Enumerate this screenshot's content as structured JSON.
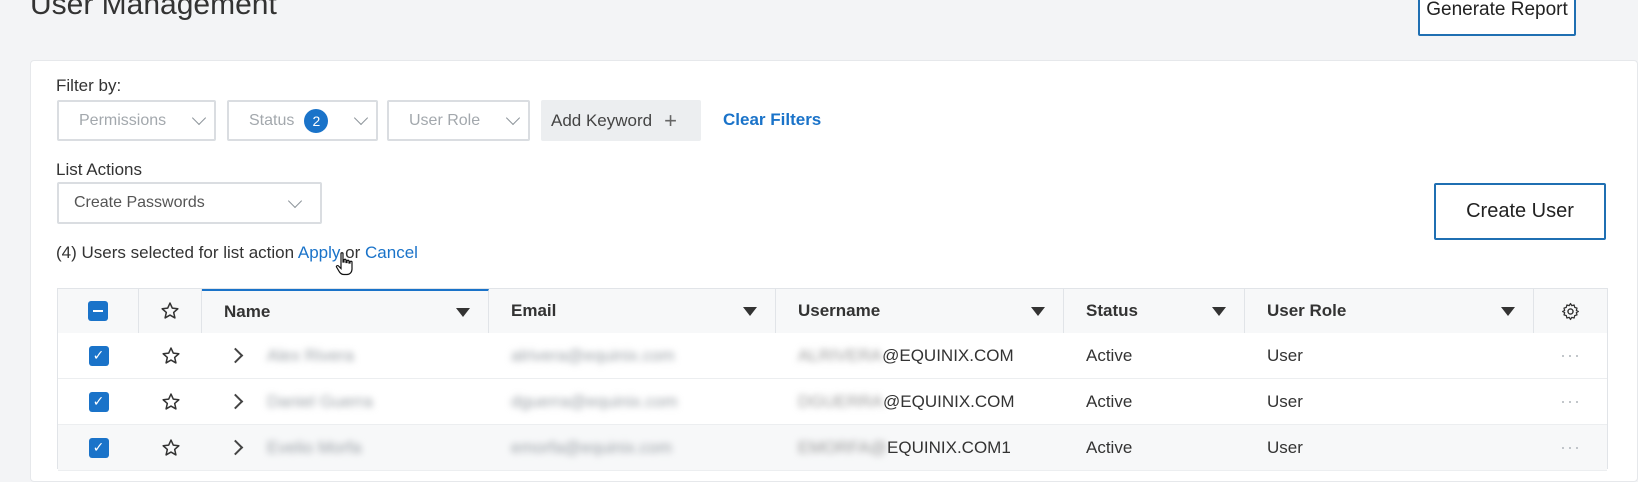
{
  "header": {
    "title": "User Management",
    "generate_report_label": "Generate Report"
  },
  "filters": {
    "label": "Filter by:",
    "permissions": "Permissions",
    "status": "Status",
    "status_count": "2",
    "user_role": "User Role",
    "add_keyword": "Add Keyword",
    "clear_filters": "Clear Filters"
  },
  "list_actions": {
    "label": "List Actions",
    "selected_action": "Create Passwords",
    "selection_prefix": "(4) Users selected for list action",
    "apply": "Apply",
    "or": "or",
    "cancel": "Cancel"
  },
  "create_user_label": "Create User",
  "table": {
    "columns": [
      "Name",
      "Email",
      "Username",
      "Status",
      "User Role"
    ],
    "rows": [
      {
        "name": "Alex Rivera",
        "email": "alrivera@equinix.com",
        "username_masked": "ALRIVERA",
        "username_suffix": "@EQUINIX.COM",
        "status": "Active",
        "role": "User",
        "more": "···"
      },
      {
        "name": "Daniel Guerra",
        "email": "dguerra@equinix.com",
        "username_masked": "DGUERRA",
        "username_suffix": "@EQUINIX.COM",
        "status": "Active",
        "role": "User",
        "more": "···"
      },
      {
        "name": "Evelio Morfa",
        "email": "emorfa@equinix.com",
        "username_masked": "EMORFA@",
        "username_suffix": "EQUINIX.COM1",
        "status": "Active",
        "role": "User",
        "more": "···"
      }
    ]
  },
  "colors": {
    "accent": "#1a73c9",
    "button_border": "#1f6fb2"
  }
}
